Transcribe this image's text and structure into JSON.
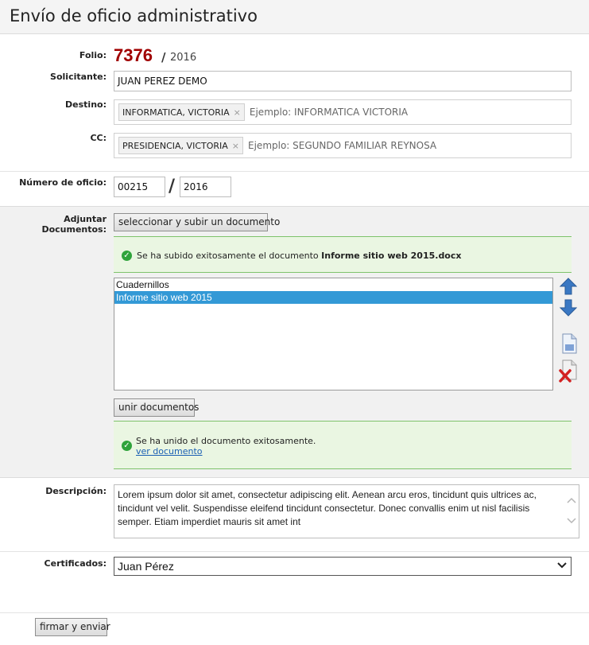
{
  "header": {
    "title": "Envío de oficio administrativo"
  },
  "folio": {
    "label": "Folio:",
    "number": "7376",
    "slash": "/",
    "year": "2016"
  },
  "solicitante": {
    "label": "Solicitante:",
    "value": "JUAN PEREZ DEMO"
  },
  "destino": {
    "label": "Destino:",
    "tag": "INFORMATICA, VICTORIA",
    "tag_remove": "×",
    "placeholder": "Ejemplo: INFORMATICA VICTORIA"
  },
  "cc": {
    "label": "CC:",
    "tag": "PRESIDENCIA, VICTORIA",
    "tag_remove": "×",
    "placeholder": "Ejemplo: SEGUNDO FAMILIAR REYNOSA"
  },
  "numero_oficio": {
    "label": "Número de oficio:",
    "number": "00215",
    "slash": "/",
    "year": "2016"
  },
  "adjuntar": {
    "label": "Adjuntar Documentos:",
    "upload_button": "seleccionar y subir un documento",
    "upload_msg_prefix": "Se ha subido exitosamente el documento ",
    "upload_msg_doc": "Informe sitio web 2015.docx",
    "documents": [
      {
        "name": "Cuadernillos",
        "selected": false
      },
      {
        "name": "Informe sitio web 2015",
        "selected": true
      }
    ],
    "merge_button": "unir documentos",
    "merge_msg": "Se ha unido el documento exitosamente.",
    "merge_link": "ver documento"
  },
  "descripcion": {
    "label": "Descripción:",
    "value": "Lorem ipsum dolor sit amet, consectetur adipiscing elit. Aenean arcu eros, tincidunt quis ultrices ac, tincidunt vel velit. Suspendisse eleifend tincidunt consectetur. Donec convallis enim ut nisl facilisis semper. Etiam imperdiet mauris sit amet int"
  },
  "certificados": {
    "label": "Certificados:",
    "selected": "Juan Pérez"
  },
  "submit": {
    "label": "firmar y enviar"
  },
  "icons": {
    "move_up": "arrow-up-icon",
    "move_down": "arrow-down-icon",
    "view_doc": "document-icon",
    "delete_doc": "delete-document-icon",
    "success": "check-circle-icon",
    "scroll_up": "scroll-up-icon",
    "scroll_down": "scroll-down-icon",
    "dropdown": "chevron-down-icon"
  },
  "colors": {
    "folio": "#a00000",
    "success_bg": "#eaf6e2",
    "success_border": "#7ec36b",
    "selected_item": "#3399d6",
    "arrow_blue": "#3a78c3"
  }
}
